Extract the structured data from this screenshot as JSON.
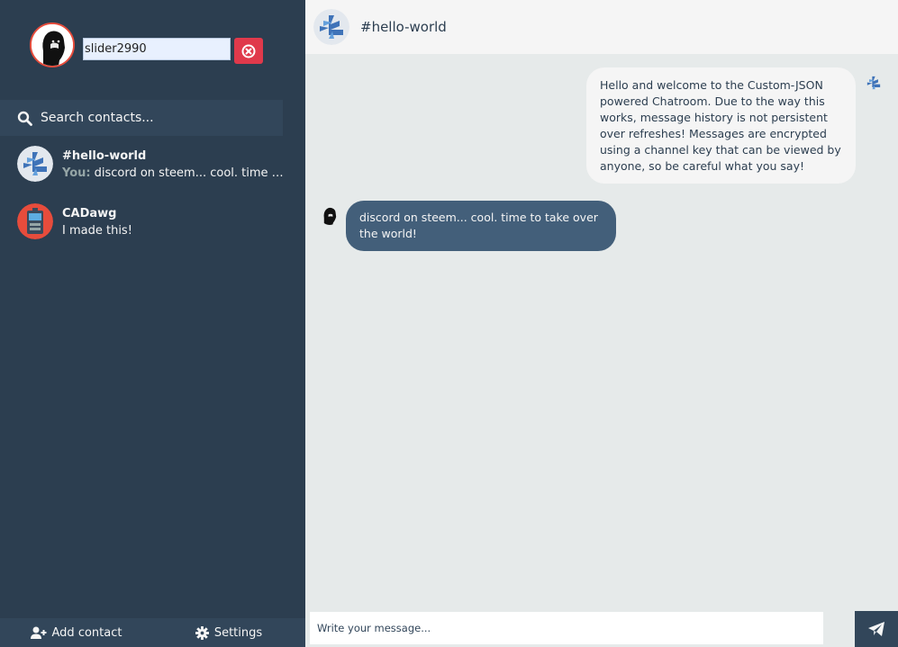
{
  "theme": {
    "sidebar_bg": "#2c3e50",
    "sidebar_panel_bg": "#32465a",
    "accent_red": "#e0394b",
    "sent_bubble_bg": "#435f7a",
    "received_bubble_bg": "#f5f5f5",
    "chat_bg": "#e6eaea"
  },
  "profile": {
    "username": "slider2990",
    "avatar_icon": "bearded-man-avatar",
    "logout_icon": "times-circle-icon"
  },
  "search": {
    "placeholder": "Search contacts...",
    "icon": "search-icon"
  },
  "contacts": [
    {
      "name": "#hello-world",
      "you_label": "You:",
      "preview": "discord on steem... cool. time to take over the world!",
      "avatar_icon": "steem-logo-avatar"
    },
    {
      "name": "CADawg",
      "preview": "I made this!",
      "avatar_icon": "robot-avatar"
    }
  ],
  "bottom_bar": {
    "add_contact_label": "Add contact",
    "add_contact_icon": "user-plus-icon",
    "settings_label": "Settings",
    "settings_icon": "gear-icon"
  },
  "chat": {
    "channel_name": "#hello-world",
    "messages": [
      {
        "type": "replies",
        "text": "Hello and welcome to the Custom-JSON powered Chatroom. Due to the way this works, message history is not persistent over refreshes! Messages are encrypted using a channel key that can be viewed by anyone, so be careful what you say!"
      },
      {
        "type": "sent",
        "text": "discord on steem... cool. time to take over the world!"
      }
    ],
    "composer": {
      "placeholder": "Write your message...",
      "send_icon": "paper-plane-icon"
    }
  }
}
